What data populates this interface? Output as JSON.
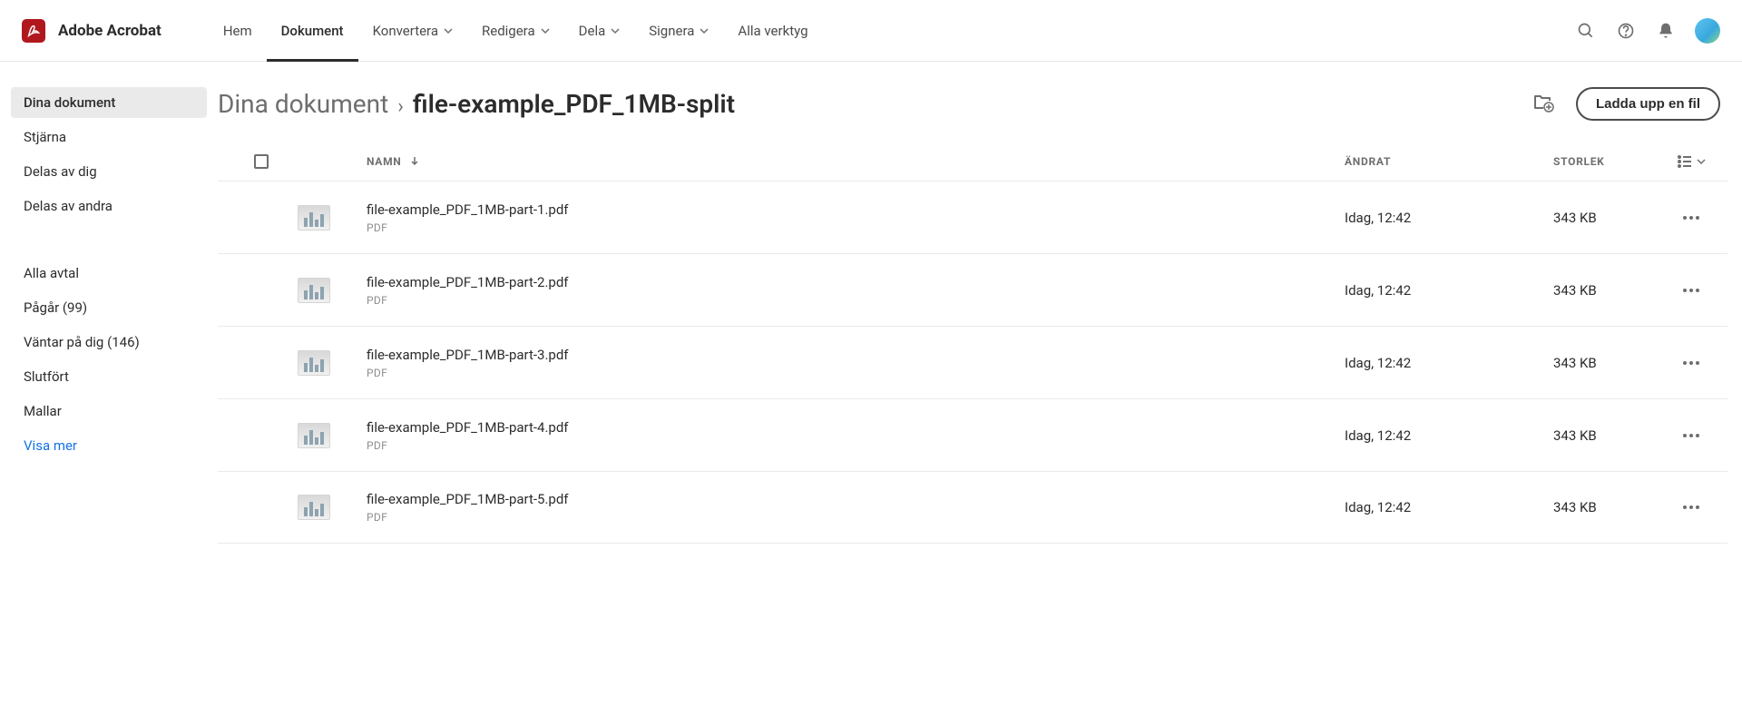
{
  "brand": {
    "name": "Adobe Acrobat"
  },
  "nav": {
    "hem": "Hem",
    "dokument": "Dokument",
    "konvertera": "Konvertera",
    "redigera": "Redigera",
    "dela": "Dela",
    "signera": "Signera",
    "alla_verktyg": "Alla verktyg"
  },
  "sidebar": {
    "group1": [
      {
        "label": "Dina dokument",
        "active": true
      },
      {
        "label": "Stjärna",
        "active": false
      },
      {
        "label": "Delas av dig",
        "active": false
      },
      {
        "label": "Delas av andra",
        "active": false
      }
    ],
    "group2": [
      {
        "label": "Alla avtal"
      },
      {
        "label": "Pågår (99)"
      },
      {
        "label": "Väntar på dig (146)"
      },
      {
        "label": "Slutfört"
      },
      {
        "label": "Mallar"
      }
    ],
    "show_more": "Visa mer"
  },
  "breadcrumb": {
    "parent": "Dina dokument",
    "current": "file-example_PDF_1MB-split"
  },
  "actions": {
    "upload": "Ladda upp en fil"
  },
  "columns": {
    "name": "NAMN",
    "modified": "ÄNDRAT",
    "size": "STORLEK"
  },
  "files": [
    {
      "name": "file-example_PDF_1MB-part-1.pdf",
      "type": "PDF",
      "modified": "Idag, 12:42",
      "size": "343 KB"
    },
    {
      "name": "file-example_PDF_1MB-part-2.pdf",
      "type": "PDF",
      "modified": "Idag, 12:42",
      "size": "343 KB"
    },
    {
      "name": "file-example_PDF_1MB-part-3.pdf",
      "type": "PDF",
      "modified": "Idag, 12:42",
      "size": "343 KB"
    },
    {
      "name": "file-example_PDF_1MB-part-4.pdf",
      "type": "PDF",
      "modified": "Idag, 12:42",
      "size": "343 KB"
    },
    {
      "name": "file-example_PDF_1MB-part-5.pdf",
      "type": "PDF",
      "modified": "Idag, 12:42",
      "size": "343 KB"
    }
  ]
}
